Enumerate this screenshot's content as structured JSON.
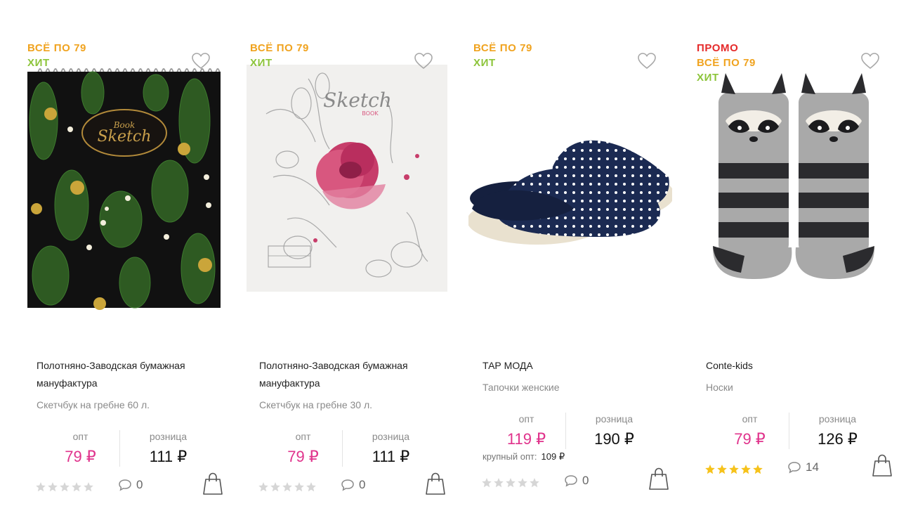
{
  "colors": {
    "promo": "#e52a2a",
    "sale": "#f0a31f",
    "hit": "#8cc43a",
    "opt_price": "#e0338c",
    "star_active": "#f6c21a",
    "star_inactive": "#d6d6d6"
  },
  "labels": {
    "opt": "опт",
    "retail": "розница",
    "bulk": "крупный опт:"
  },
  "products": [
    {
      "badges": {
        "sale": "ВСЁ ПО 79",
        "hit": "ХИТ"
      },
      "image": "sketchbook-cactus-cover",
      "brand": "Полотняно-Заводская бумажная мануфактура",
      "name": "Скетчбук на гребне 60 л.",
      "price_opt": "79 ₽",
      "price_retail": "111 ₽",
      "rating": 0,
      "comments": "0"
    },
    {
      "badges": {
        "sale": "ВСЁ ПО 79",
        "hit": "ХИТ"
      },
      "image": "sketchbook-rose-cover",
      "brand": "Полотняно-Заводская бумажная мануфактура",
      "name": "Скетчбук на гребне 30 л.",
      "price_opt": "79 ₽",
      "price_retail": "111 ₽",
      "rating": 0,
      "comments": "0"
    },
    {
      "badges": {
        "sale": "ВСЁ ПО 79",
        "hit": "ХИТ"
      },
      "image": "polka-dot-slippers",
      "brand": "ТАР МОДА",
      "name": "Тапочки женские",
      "price_opt": "119 ₽",
      "price_retail": "190 ₽",
      "bulk_price": "109 ₽",
      "rating": 0,
      "comments": "0"
    },
    {
      "badges": {
        "promo": "ПРОМО",
        "sale": "ВСЁ ПО 79",
        "hit": "ХИТ"
      },
      "image": "raccoon-socks",
      "brand": "Conte-kids",
      "name": "Носки",
      "price_opt": "79 ₽",
      "price_retail": "126 ₽",
      "rating": 5,
      "comments": "14"
    }
  ]
}
